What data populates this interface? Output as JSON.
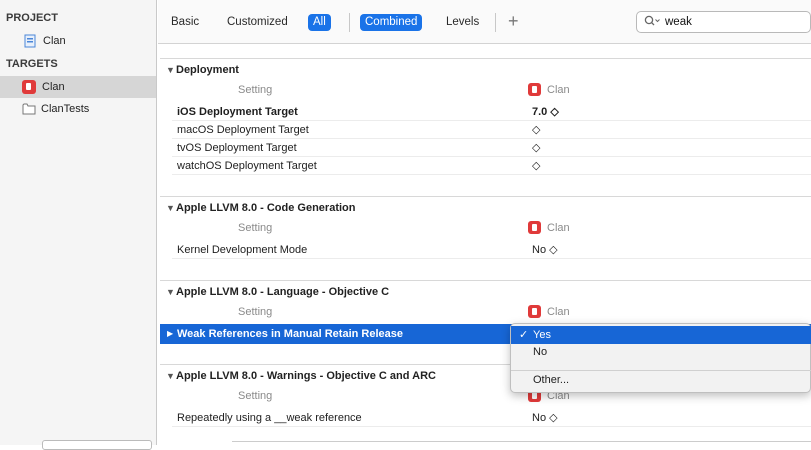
{
  "sidebar": {
    "project_header": "PROJECT",
    "project_item": "Clan",
    "targets_header": "TARGETS",
    "targets": [
      {
        "label": "Clan",
        "icon": "app-icon"
      },
      {
        "label": "ClanTests",
        "icon": "folder-icon"
      }
    ]
  },
  "toolbar": {
    "basic": "Basic",
    "customized": "Customized",
    "all": "All",
    "combined": "Combined",
    "levels": "Levels",
    "add": "+",
    "search_value": "weak"
  },
  "sections": [
    {
      "title": "Deployment",
      "col_setting": "Setting",
      "col_target": "Clan",
      "rows": [
        {
          "name": "iOS Deployment Target",
          "value": "7.0 ◇"
        },
        {
          "name": "macOS Deployment Target",
          "value": "◇"
        },
        {
          "name": "tvOS Deployment Target",
          "value": "◇"
        },
        {
          "name": "watchOS Deployment Target",
          "value": "◇"
        }
      ]
    },
    {
      "title": "Apple LLVM 8.0 - Code Generation",
      "col_setting": "Setting",
      "col_target": "Clan",
      "rows": [
        {
          "name": "Kernel Development Mode",
          "value": "No ◇"
        }
      ]
    },
    {
      "title": "Apple LLVM 8.0 - Language - Objective C",
      "col_setting": "Setting",
      "col_target": "Clan",
      "rows": [
        {
          "name": "Weak References in Manual Retain Release",
          "value": ""
        }
      ]
    },
    {
      "title": "Apple LLVM 8.0 - Warnings - Objective C and ARC",
      "col_setting": "Setting",
      "col_target": "Clan",
      "rows": [
        {
          "name": "Repeatedly using a __weak reference",
          "value": "No ◇"
        }
      ]
    }
  ],
  "popup": {
    "options": [
      "Yes",
      "No",
      "Other..."
    ],
    "selected": "Yes",
    "checkmark": "✓"
  },
  "colors": {
    "accent": "#1766d6",
    "app_icon": "#e03a3a"
  }
}
